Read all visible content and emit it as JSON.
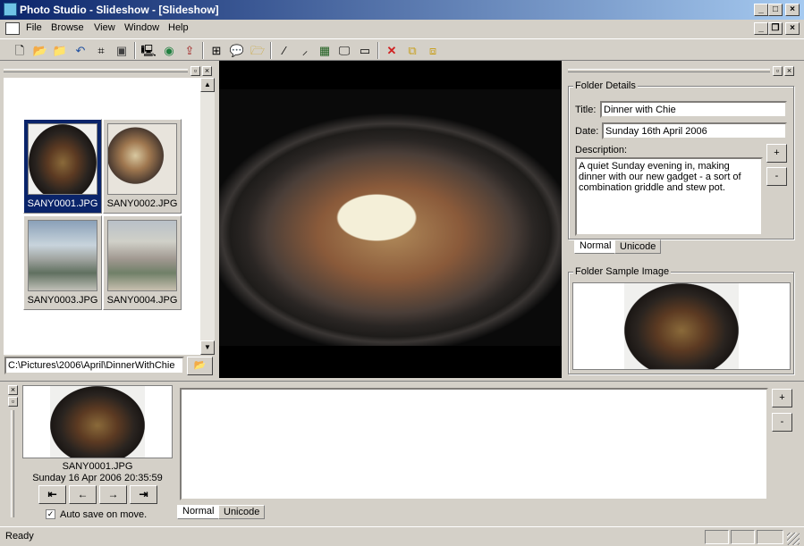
{
  "window": {
    "title": "Photo Studio - Slideshow - [Slideshow]"
  },
  "menu": [
    "File",
    "Browse",
    "View",
    "Window",
    "Help"
  ],
  "thumbnails": [
    {
      "label": "SANY0001.JPG",
      "selected": true
    },
    {
      "label": "SANY0002.JPG",
      "selected": false
    },
    {
      "label": "SANY0003.JPG",
      "selected": false
    },
    {
      "label": "SANY0004.JPG",
      "selected": false
    }
  ],
  "path": {
    "value": "C:\\Pictures\\2006\\April\\DinnerWithChie"
  },
  "folder_details": {
    "group_label": "Folder Details",
    "title_label": "Title:",
    "title_value": "Dinner with Chie",
    "date_label": "Date:",
    "date_value": "Sunday 16th April 2006",
    "description_label": "Description:",
    "description_value": "A quiet Sunday evening in, making dinner with our new gadget - a sort of combination griddle and stew pot.",
    "tabs": [
      "Normal",
      "Unicode"
    ],
    "plus": "+",
    "minus": "-"
  },
  "folder_sample": {
    "group_label": "Folder Sample Image"
  },
  "current_image": {
    "filename": "SANY0001.JPG",
    "datetime": "Sunday 16 Apr 2006 20:35:59",
    "autosave_label": "Auto save on move."
  },
  "caption": {
    "tabs": [
      "Normal",
      "Unicode"
    ],
    "plus": "+",
    "minus": "-"
  },
  "status": {
    "text": "Ready"
  }
}
